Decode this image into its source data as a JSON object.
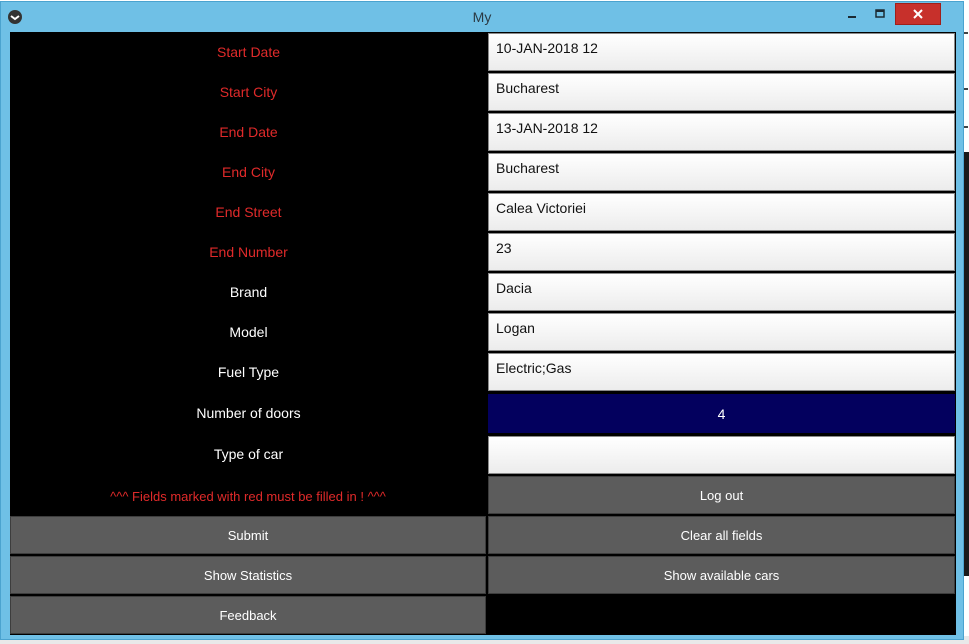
{
  "window": {
    "title": "My"
  },
  "form": {
    "rows": [
      {
        "label": "Start Date",
        "required": true,
        "value": "10-JAN-2018 12"
      },
      {
        "label": "Start City",
        "required": true,
        "value": "Bucharest"
      },
      {
        "label": "End Date",
        "required": true,
        "value": "13-JAN-2018 12"
      },
      {
        "label": "End City",
        "required": true,
        "value": "Bucharest"
      },
      {
        "label": "End Street",
        "required": true,
        "value": "Calea Victoriei"
      },
      {
        "label": "End Number",
        "required": true,
        "value": "23"
      },
      {
        "label": "Brand",
        "required": false,
        "value": "Dacia"
      },
      {
        "label": "Model",
        "required": false,
        "value": "Logan"
      },
      {
        "label": "Fuel Type",
        "required": false,
        "value": "Electric;Gas"
      },
      {
        "label": "Number of doors",
        "required": false,
        "value": "4"
      },
      {
        "label": "Type of car",
        "required": false,
        "value": ""
      }
    ],
    "warning": "^^^ Fields marked with red must be filled in ! ^^^"
  },
  "buttons": {
    "logout": "Log out",
    "submit": "Submit",
    "clear": "Clear all fields",
    "statistics": "Show Statistics",
    "available": "Show available cars",
    "feedback": "Feedback"
  },
  "colors": {
    "required_label": "#e02a2a",
    "selected_field": "#03005e",
    "button": "#5c5c5c",
    "titlebar": "#6fc0e6",
    "close_button": "#c7302b"
  }
}
